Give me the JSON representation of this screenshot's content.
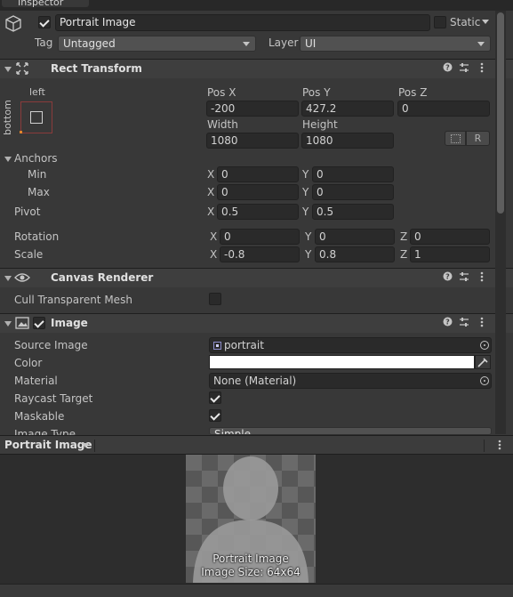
{
  "window": {
    "tab_label": "Inspector"
  },
  "object": {
    "active": true,
    "name": "Portrait Image",
    "static_label": "Static",
    "tag_label": "Tag",
    "tag_value": "Untagged",
    "layer_label": "Layer",
    "layer_value": "UI"
  },
  "rect_transform": {
    "title": "Rect Transform",
    "anchor_h": "left",
    "anchor_v": "bottom",
    "pos_x_label": "Pos X",
    "pos_y_label": "Pos Y",
    "pos_z_label": "Pos Z",
    "pos_x": "-200",
    "pos_y": "427.2",
    "pos_z": "0",
    "width_label": "Width",
    "height_label": "Height",
    "width": "1080",
    "height": "1080",
    "r_button": "R",
    "anchors_label": "Anchors",
    "min_label": "Min",
    "max_label": "Max",
    "min_x": "0",
    "min_y": "0",
    "max_x": "0",
    "max_y": "0",
    "pivot_label": "Pivot",
    "pivot_x": "0.5",
    "pivot_y": "0.5",
    "rotation_label": "Rotation",
    "rot_x": "0",
    "rot_y": "0",
    "rot_z": "0",
    "scale_label": "Scale",
    "scale_x": "-0.8",
    "scale_y": "0.8",
    "scale_z": "1",
    "axis_x": "X",
    "axis_y": "Y",
    "axis_z": "Z"
  },
  "canvas_renderer": {
    "title": "Canvas Renderer",
    "cull_label": "Cull Transparent Mesh",
    "cull_checked": false
  },
  "image": {
    "title": "Image",
    "enabled": true,
    "source_label": "Source Image",
    "source_value": "portrait",
    "color_label": "Color",
    "color_value": "#ffffff",
    "material_label": "Material",
    "material_value": "None (Material)",
    "raycast_label": "Raycast Target",
    "raycast_checked": true,
    "maskable_label": "Maskable",
    "maskable_checked": true,
    "image_type_label": "Image Type",
    "image_type_value": "Simple"
  },
  "preview": {
    "title": "Portrait Image",
    "name": "Portrait Image",
    "size_text": "Image Size: 64x64"
  },
  "colors": {
    "accent_orange": "#e0852b",
    "panel_bg": "#383838",
    "field_bg": "#2a2a2a"
  }
}
